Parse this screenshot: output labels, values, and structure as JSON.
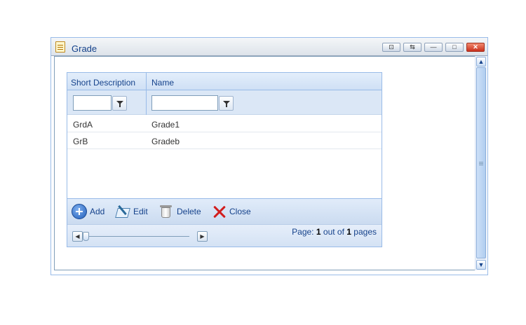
{
  "window": {
    "title": "Grade",
    "title_buttons": [
      "restore-icon",
      "refresh-icon",
      "minimize-icon",
      "maximize-icon",
      "close-icon"
    ]
  },
  "grid": {
    "columns": [
      "Short Description",
      "Name"
    ],
    "filter_values": [
      "",
      ""
    ],
    "rows": [
      [
        "GrdA",
        "Grade1"
      ],
      [
        "GrB",
        "Gradeb"
      ]
    ]
  },
  "toolbar": {
    "add_label": "Add",
    "edit_label": "Edit",
    "delete_label": "Delete",
    "close_label": "Close"
  },
  "pager": {
    "prefix": "Page:",
    "current": "1",
    "middle": "out of",
    "total": "1",
    "suffix": "pages"
  },
  "colors": {
    "header_text": "#15428b",
    "border": "#99bbe8",
    "close_icon": "#d21e1e"
  }
}
